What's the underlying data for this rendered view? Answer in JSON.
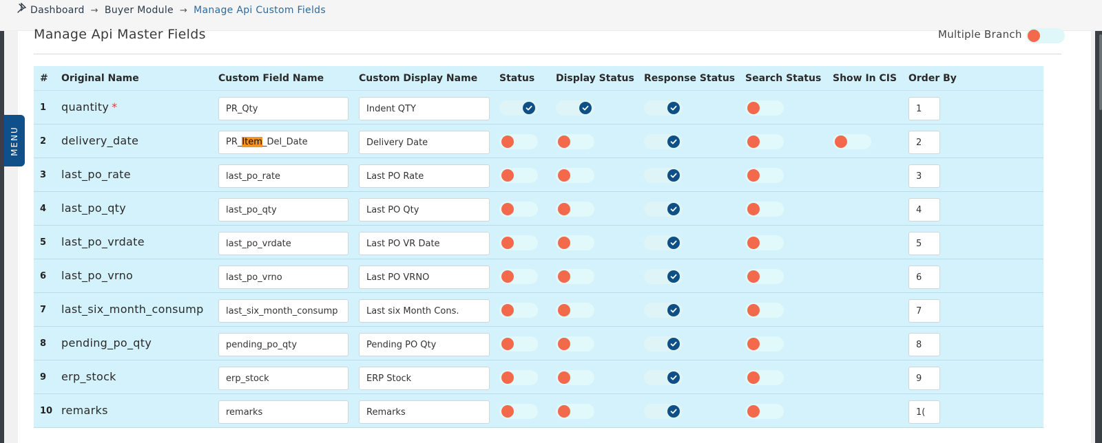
{
  "breadcrumb": {
    "items": [
      "Dashboard",
      "Buyer Module",
      "Manage Api Custom Fields"
    ],
    "separator": "→"
  },
  "side_menu": {
    "label": "MENU"
  },
  "card": {
    "title": "Manage Api Master Fields",
    "multiple_branch_label": "Multiple Branch",
    "multiple_branch_on": false
  },
  "table": {
    "headers": [
      "#",
      "Original Name",
      "Custom Field Name",
      "Custom Display Name",
      "Status",
      "Display Status",
      "Response Status",
      "Search Status",
      "Show In CIS",
      "Order By"
    ],
    "rows": [
      {
        "num": "1",
        "name": "quantity",
        "required": true,
        "custom": "PR_Qty",
        "display": "Indent QTY",
        "status": true,
        "display_status": true,
        "response_status": true,
        "search_status": false,
        "show_in_cis": null,
        "order": "1"
      },
      {
        "num": "2",
        "name": "delivery_date",
        "required": false,
        "custom": "PR_Item_Del_Date",
        "custom_parts": [
          "PR_",
          "Item",
          "_Del_Date"
        ],
        "display": "Delivery Date",
        "status": false,
        "display_status": false,
        "response_status": true,
        "search_status": false,
        "show_in_cis": false,
        "order": "2"
      },
      {
        "num": "3",
        "name": "last_po_rate",
        "required": false,
        "custom": "last_po_rate",
        "display": "Last PO Rate",
        "status": false,
        "display_status": false,
        "response_status": true,
        "search_status": false,
        "show_in_cis": null,
        "order": "3"
      },
      {
        "num": "4",
        "name": "last_po_qty",
        "required": false,
        "custom": "last_po_qty",
        "display": "Last PO Qty",
        "status": false,
        "display_status": false,
        "response_status": true,
        "search_status": false,
        "show_in_cis": null,
        "order": "4"
      },
      {
        "num": "5",
        "name": "last_po_vrdate",
        "required": false,
        "custom": "last_po_vrdate",
        "display": "Last PO VR Date",
        "status": false,
        "display_status": false,
        "response_status": true,
        "search_status": false,
        "show_in_cis": null,
        "order": "5"
      },
      {
        "num": "6",
        "name": "last_po_vrno",
        "required": false,
        "custom": "last_po_vrno",
        "display": "Last PO VRNO",
        "status": false,
        "display_status": false,
        "response_status": true,
        "search_status": false,
        "show_in_cis": null,
        "order": "6"
      },
      {
        "num": "7",
        "name": "last_six_month_consump",
        "required": false,
        "custom": "last_six_month_consump",
        "display": "Last six Month Cons.",
        "status": false,
        "display_status": false,
        "response_status": true,
        "search_status": false,
        "show_in_cis": null,
        "order": "7"
      },
      {
        "num": "8",
        "name": "pending_po_qty",
        "required": false,
        "custom": "pending_po_qty",
        "display": "Pending PO Qty",
        "status": false,
        "display_status": false,
        "response_status": true,
        "search_status": false,
        "show_in_cis": null,
        "order": "8"
      },
      {
        "num": "9",
        "name": "erp_stock",
        "required": false,
        "custom": "erp_stock",
        "display": "ERP Stock",
        "status": false,
        "display_status": false,
        "response_status": true,
        "search_status": false,
        "show_in_cis": null,
        "order": "9"
      },
      {
        "num": "10",
        "name": "remarks",
        "required": false,
        "custom": "remarks",
        "display": "Remarks",
        "status": false,
        "display_status": false,
        "response_status": true,
        "search_status": false,
        "show_in_cis": null,
        "order": "1("
      }
    ]
  },
  "colors": {
    "accent": "#0e4f86",
    "toggle_off_knob": "#f26a4b",
    "table_bg": "#d4f2fb",
    "highlight": "#f39322"
  },
  "icons": {
    "breadcrumb_home": "pin-icon",
    "toggle_on": "check-icon"
  }
}
